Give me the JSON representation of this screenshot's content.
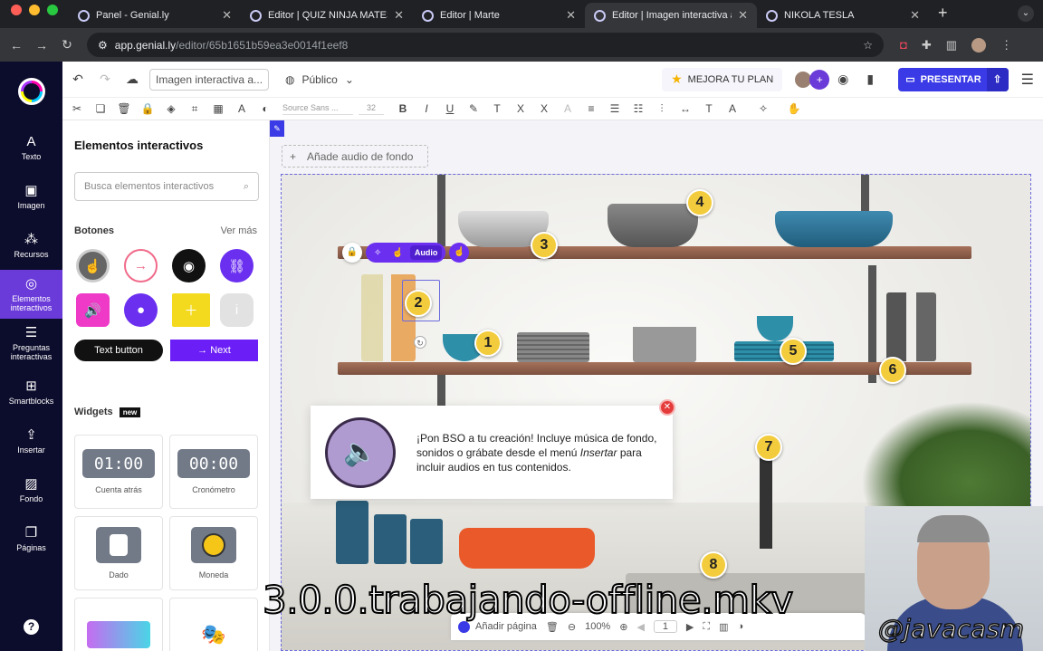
{
  "browser": {
    "tabs": [
      {
        "title": "Panel - Genial.ly",
        "active": false
      },
      {
        "title": "Editor | QUIZ NINJA MATES",
        "active": false
      },
      {
        "title": "Editor | Marte",
        "active": false
      },
      {
        "title": "Editor | Imagen interactiva au",
        "active": true
      },
      {
        "title": "NIKOLA TESLA",
        "active": false
      }
    ],
    "url_host": "app.genial.ly",
    "url_path": "/editor/65b1651b59ea3e0014f1eef8"
  },
  "rail": {
    "items": [
      {
        "label": "Texto",
        "icon": "A"
      },
      {
        "label": "Imagen",
        "icon": "▣"
      },
      {
        "label": "Recursos",
        "icon": "⁂"
      },
      {
        "label": "Elementos interactivos",
        "icon": "◎",
        "active": true
      },
      {
        "label": "Preguntas interactivas",
        "icon": "☰"
      },
      {
        "label": "Smartblocks",
        "icon": "⊞"
      },
      {
        "label": "Insertar",
        "icon": "⇪"
      },
      {
        "label": "Fondo",
        "icon": "▨"
      },
      {
        "label": "Páginas",
        "icon": "❐"
      }
    ],
    "help": "?"
  },
  "topbar": {
    "title_value": "Imagen interactiva a...",
    "visibility": "Público",
    "upgrade_label": "MEJORA TU PLAN",
    "present_label": "PRESENTAR"
  },
  "fmtbar": {
    "font": "Source Sans ...",
    "size": "32"
  },
  "panel": {
    "title": "Elementos interactivos",
    "search_placeholder": "Busca elementos interactivos",
    "buttons_section": "Botones",
    "see_more": "Ver más",
    "text_button": "Text button",
    "next_button": "Next",
    "widgets_section": "Widgets",
    "new_badge": "new",
    "widgets": [
      {
        "label": "Cuenta atrás",
        "display": "01:00"
      },
      {
        "label": "Cronómetro",
        "display": "00:00"
      },
      {
        "label": "Dado"
      },
      {
        "label": "Moneda"
      }
    ]
  },
  "canvas": {
    "add_audio": "Añade audio de fondo",
    "element_toolbar_audio": "Audio",
    "hotspots": [
      "1",
      "2",
      "3",
      "4",
      "5",
      "6",
      "7",
      "8"
    ],
    "popup": {
      "line1": "¡Pon BSO a tu creación! Incluye música de fondo, sonidos o grábate desde el menú ",
      "italic": "Insertar",
      "line2": " para incluir audios en tus contenidos."
    }
  },
  "bottombar": {
    "add_page": "Añadir página",
    "zoom": "100%",
    "page": "1"
  },
  "overlay": {
    "subtitle": "3.0.0.trabajando-offline.mkv",
    "handle": "@javacasm"
  }
}
